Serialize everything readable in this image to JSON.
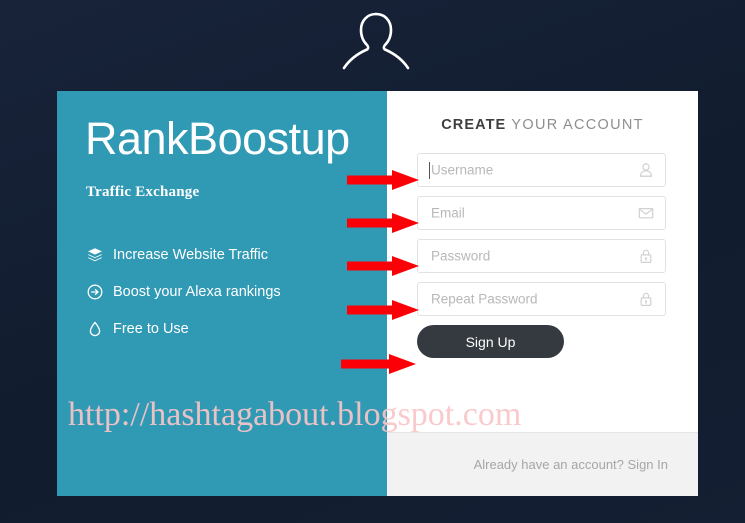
{
  "theme": {
    "page_background": "#131f33",
    "panel_teal": "#3099b4",
    "card_white": "#ffffff",
    "footer_gray": "#f2f2f2",
    "button_dark": "#343a40",
    "arrow_red": "#fb0007",
    "placeholder_gray": "#b8b8b8",
    "watermark_pink": "#f9c6c8"
  },
  "avatar": {
    "icon": "user-silhouette-icon"
  },
  "left_panel": {
    "brand": "RankBoostup",
    "tagline": "Traffic Exchange",
    "features": [
      {
        "icon": "layers-icon",
        "label": "Increase Website Traffic"
      },
      {
        "icon": "arrow-circle-right-icon",
        "label": "Boost your Alexa rankings"
      },
      {
        "icon": "droplet-icon",
        "label": "Free to Use"
      }
    ]
  },
  "form": {
    "heading_strong": "CREATE",
    "heading_rest": " YOUR ACCOUNT",
    "fields": [
      {
        "name": "username",
        "placeholder": "Username",
        "icon": "user-icon",
        "focused": true
      },
      {
        "name": "email",
        "placeholder": "Email",
        "icon": "envelope-icon",
        "focused": false
      },
      {
        "name": "password",
        "placeholder": "Password",
        "icon": "lock-icon",
        "focused": false
      },
      {
        "name": "repeat-password",
        "placeholder": "Repeat Password",
        "icon": "lock-icon",
        "focused": false
      }
    ],
    "submit_label": "Sign Up"
  },
  "footer": {
    "text": "Already have an account? Sign In"
  },
  "annotations": {
    "arrows": [
      {
        "name": "arrow-to-username",
        "target": "username"
      },
      {
        "name": "arrow-to-email",
        "target": "email"
      },
      {
        "name": "arrow-to-password",
        "target": "password"
      },
      {
        "name": "arrow-to-repeat-password",
        "target": "repeat-password"
      },
      {
        "name": "arrow-to-signup-button",
        "target": "sign-up"
      }
    ]
  },
  "watermark": {
    "text": "http://hashtagabout.blogspot.com"
  }
}
